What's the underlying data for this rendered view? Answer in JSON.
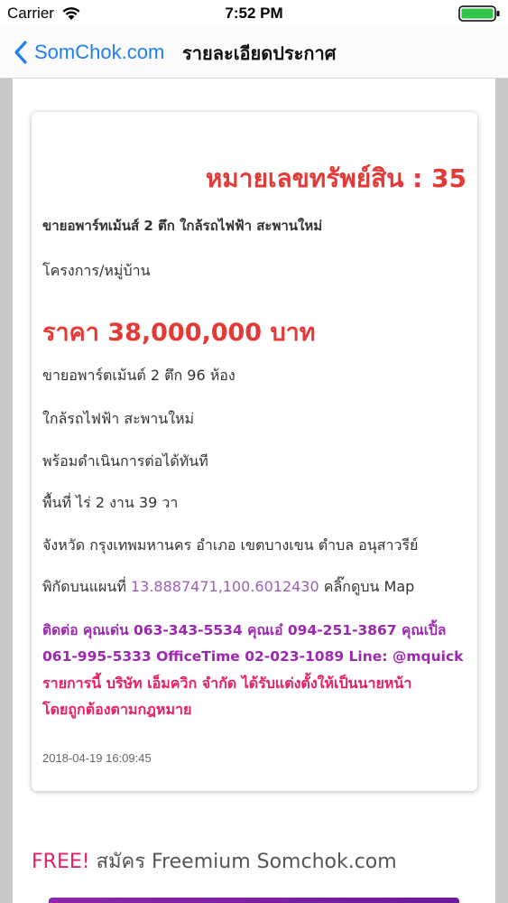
{
  "status_bar": {
    "carrier": "Carrier",
    "time": "7:52 PM"
  },
  "nav": {
    "back_label": "SomChok.com",
    "title": "รายละเอียดประกาศ"
  },
  "listing": {
    "asset_number": "หมายเลขทรัพย์สิน : 35",
    "title": "ขายอพาร์ทเม้นส์ 2 ตึก ใกล้รถไฟฟ้า สะพานใหม่",
    "project": "โครงการ/หมู่บ้าน",
    "price": "ราคา 38,000,000 บาท",
    "details": [
      "ขายอพาร์ตเม้นต์ 2 ตึก 96 ห้อง",
      "ใกล้รถไฟฟ้า สะพานใหม่",
      "พร้อมดำเนินการต่อได้ทันที",
      "พื้นที่ ไร่ 2 งาน 39 วา",
      "จังหวัด กรุงเทพมหานคร อำเภอ เขตบางเขน ตำบล อนุสาวรีย์"
    ],
    "coords_prefix": "พิกัดบนแผนที่",
    "coords": "13.8887471,100.6012430",
    "coords_suffix": "คลิ๊กดูบน Map",
    "contact_line1": "ติดต่อ คุณเด่น 063-343-5534 คุณเอ๋ 094-251-3867 คุณเปิ้ล",
    "contact_line2": "061-995-5333 OfficeTime 02-023-1089 Line: @mquick",
    "agent_line1": "รายการนี้ บริษัท เอ็มควิก จำกัด ได้รับแต่งตั้งให้เป็นนายหน้า",
    "agent_line2": "โดยถูกต้องตามกฎหมาย",
    "timestamp": "2018-04-19 16:09:45"
  },
  "promo": {
    "free_label": "FREE!",
    "text": "สมัคร Freemium Somchok.com"
  },
  "colors": {
    "accent_red": "#e53935",
    "ios_blue": "#1e7ef2",
    "contact_purple": "#9c27b0",
    "agent_pink": "#e91e63"
  }
}
